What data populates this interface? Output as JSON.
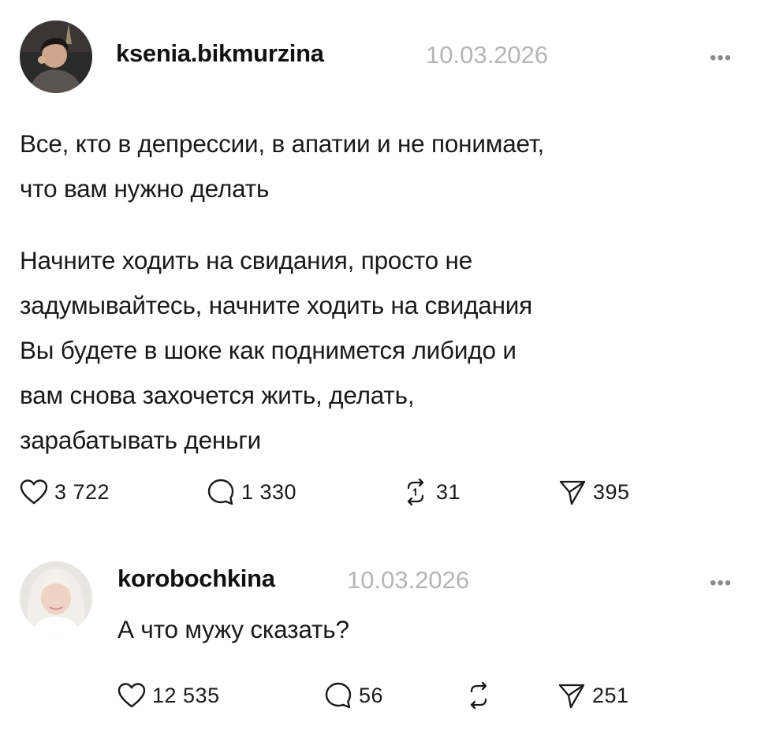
{
  "post": {
    "username": "ksenia.bikmurzina",
    "timestamp": "10.03.2026",
    "paragraph1": [
      "Все, кто в депрессии, в апатии и не понимает,",
      "что вам нужно делать"
    ],
    "paragraph2": [
      "Начните ходить на свидания, просто не",
      "задумывайтесь, начните ходить на свидания",
      "Вы будете в шоке как поднимется либидо и",
      "вам снова захочется жить, делать,",
      "зарабатывать деньги"
    ],
    "likes": "3 722",
    "comments": "1 330",
    "reposts": "31",
    "shares": "395"
  },
  "reply": {
    "username": "korobochkina",
    "timestamp": "10.03.2026",
    "text": "А что мужу сказать?",
    "likes": "12 535",
    "comments": "56",
    "shares": "251"
  },
  "icons": {
    "like": "heart-icon",
    "comment": "speech-bubble-icon",
    "repost": "repost-arrows-icon",
    "share": "paper-plane-icon",
    "more": "ellipsis-icon"
  }
}
